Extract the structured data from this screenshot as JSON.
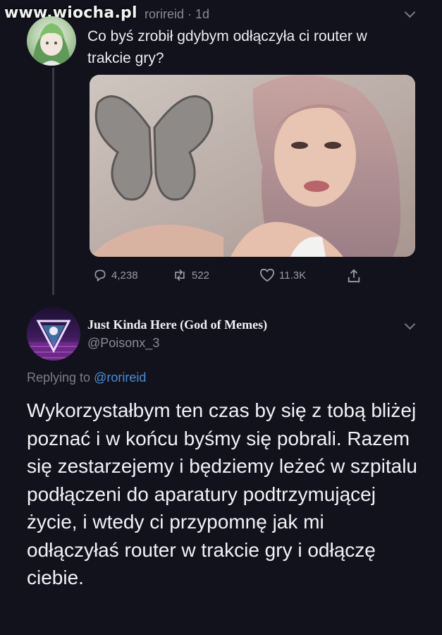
{
  "watermark": "www.wiocha.pl",
  "tweet1": {
    "username": "rorireid",
    "time": "1d",
    "text": "Co byś zrobił gdybym odłączyła ci router w trakcie gry?",
    "stats": {
      "replies": "4,238",
      "retweets": "522",
      "likes": "11.3K"
    }
  },
  "tweet2": {
    "display_name": "Just Kinda Here (God of Memes)",
    "handle": "@Poisonx_3",
    "replying_prefix": "Replying to",
    "replying_to": "@rorireid",
    "text": "Wykorzystałbym ten czas by się z tobą bliżej poznać i w końcu byśmy się pobrali. Razem się zestarzejemy i będziemy leżeć w szpitalu podłączeni do aparatury podtrzymującej życie, i wtedy ci przypomnę jak mi odłączyłaś router w trakcie gry i odłączę ciebie."
  },
  "icons": [
    "reply-icon",
    "retweet-icon",
    "like-icon",
    "share-icon",
    "chevron-down-icon"
  ]
}
